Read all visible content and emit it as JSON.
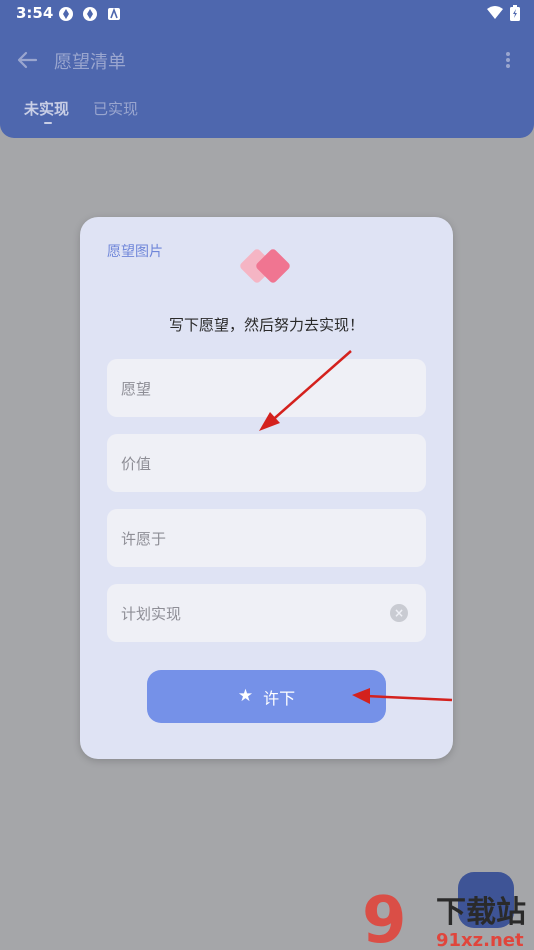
{
  "status": {
    "time": "3:54"
  },
  "header": {
    "title": "愿望清单"
  },
  "tabs": [
    {
      "label": "未实现",
      "active": true
    },
    {
      "label": "已实现",
      "active": false
    }
  ],
  "dialog": {
    "image_link": "愿望图片",
    "subtitle": "写下愿望，然后努力去实现！",
    "fields": [
      {
        "placeholder": "愿望"
      },
      {
        "placeholder": "价值"
      },
      {
        "placeholder": "许愿于"
      },
      {
        "placeholder": "计划实现"
      }
    ],
    "submit_label": "许下"
  },
  "watermark": {
    "text": "下载站",
    "url": "91xz.net",
    "mark": "9"
  },
  "colors": {
    "accent": "#7591e8",
    "appbar": "#4e67ae",
    "dialog_bg": "#dfe3f4",
    "arrow": "#d4211d"
  }
}
